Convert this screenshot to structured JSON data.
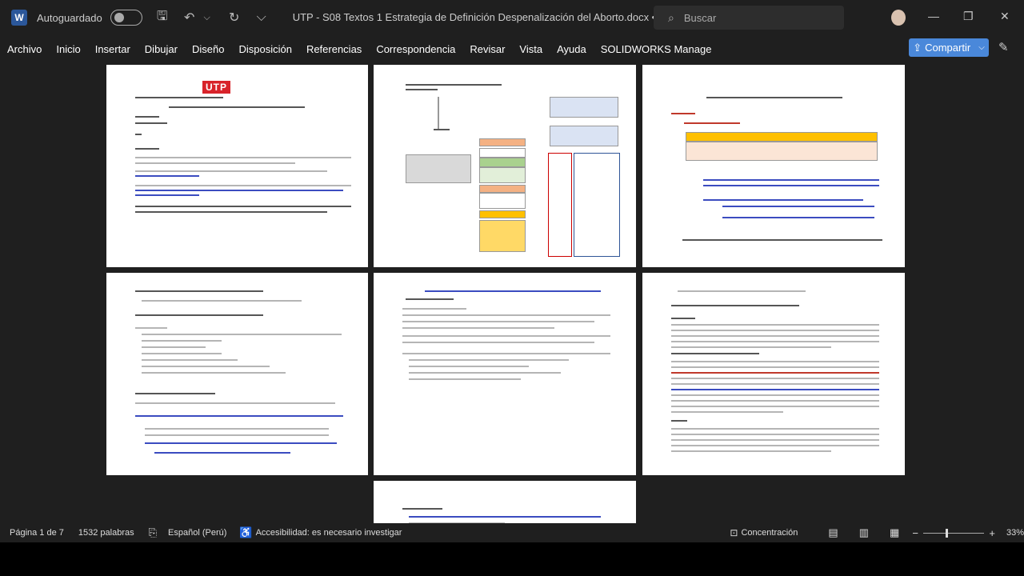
{
  "titlebar": {
    "autosave_label": "Autoguardado",
    "doc_title": "UTP - S08 Textos 1 Estrategia de Definición Despenalización del Aborto.docx  •  Guardado  ⌵",
    "search_placeholder": "Buscar"
  },
  "menu": {
    "items": [
      "Archivo",
      "Inicio",
      "Insertar",
      "Dibujar",
      "Diseño",
      "Disposición",
      "Referencias",
      "Correspondencia",
      "Revisar",
      "Vista",
      "Ayuda",
      "SOLIDWORKS Manage"
    ],
    "share_label": "Compartir"
  },
  "status": {
    "page": "Página 1 de 7",
    "words": "1532 palabras",
    "language": "Español (Perú)",
    "accessibility": "Accesibilidad: es necesario investigar",
    "focus": "Concentración",
    "zoom": "33%"
  },
  "colors": {
    "accent": "#4a88da",
    "brand": "#2b579a",
    "utp_red": "#d8232a"
  }
}
